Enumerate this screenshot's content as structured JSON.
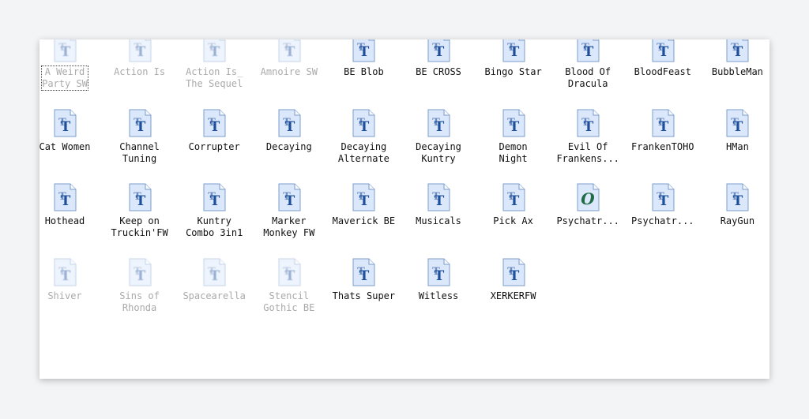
{
  "window": {
    "type": "file-explorer-icon-view"
  },
  "files": [
    {
      "label": "A Weird\nParty  SW",
      "icon": "truetype-font-icon",
      "faded": true,
      "focused": true
    },
    {
      "label": "Action Is",
      "icon": "truetype-font-icon",
      "faded": true
    },
    {
      "label": "Action Is_\nThe Sequel",
      "icon": "truetype-font-icon",
      "faded": true
    },
    {
      "label": "Amnoire  SW",
      "icon": "truetype-font-icon",
      "faded": true
    },
    {
      "label": "BE Blob",
      "icon": "truetype-font-icon"
    },
    {
      "label": "BE CROSS",
      "icon": "truetype-font-icon"
    },
    {
      "label": "Bingo Star",
      "icon": "truetype-font-icon"
    },
    {
      "label": "Blood Of\nDracula",
      "icon": "truetype-font-icon"
    },
    {
      "label": "BloodFeast",
      "icon": "truetype-font-icon"
    },
    {
      "label": "BubbleMan",
      "icon": "truetype-font-icon"
    },
    {
      "label": "Cat Women",
      "icon": "truetype-font-icon"
    },
    {
      "label": "Channel\nTuning",
      "icon": "truetype-font-icon"
    },
    {
      "label": "Corrupter",
      "icon": "truetype-font-icon"
    },
    {
      "label": "Decaying",
      "icon": "truetype-font-icon"
    },
    {
      "label": "Decaying\nAlternate",
      "icon": "truetype-font-icon"
    },
    {
      "label": "Decaying\nKuntry",
      "icon": "truetype-font-icon"
    },
    {
      "label": "Demon\nNight",
      "icon": "truetype-font-icon"
    },
    {
      "label": "Evil Of\nFrankens...",
      "icon": "truetype-font-icon"
    },
    {
      "label": "FrankenTOHO",
      "icon": "truetype-font-icon"
    },
    {
      "label": "HMan",
      "icon": "truetype-font-icon"
    },
    {
      "label": "Hothead",
      "icon": "truetype-font-icon"
    },
    {
      "label": "Keep on\nTruckin'FW",
      "icon": "truetype-font-icon"
    },
    {
      "label": "Kuntry\nCombo  3in1",
      "icon": "truetype-font-icon"
    },
    {
      "label": "Marker\nMonkey FW",
      "icon": "truetype-font-icon"
    },
    {
      "label": "Maverick BE",
      "icon": "truetype-font-icon"
    },
    {
      "label": "Musicals",
      "icon": "truetype-font-icon"
    },
    {
      "label": "Pick Ax",
      "icon": "truetype-font-icon"
    },
    {
      "label": "Psychatr...",
      "icon": "opentype-font-icon"
    },
    {
      "label": "Psychatr...",
      "icon": "truetype-font-icon"
    },
    {
      "label": "RayGun",
      "icon": "truetype-font-icon"
    },
    {
      "label": "Shiver",
      "icon": "truetype-font-icon",
      "faded": true
    },
    {
      "label": "Sins of\nRhonda",
      "icon": "truetype-font-icon",
      "faded": true
    },
    {
      "label": "Spacearella",
      "icon": "truetype-font-icon",
      "faded": true
    },
    {
      "label": "Stencil\nGothic BE",
      "icon": "truetype-font-icon",
      "faded": true
    },
    {
      "label": "Thats Super",
      "icon": "truetype-font-icon"
    },
    {
      "label": "Witless",
      "icon": "truetype-font-icon"
    },
    {
      "label": "XERKERFW",
      "icon": "truetype-font-icon"
    }
  ],
  "colors": {
    "icon_page": "#dbe8fb",
    "icon_letter": "#1e4f9c",
    "opentype_letter": "#1f6b45"
  }
}
